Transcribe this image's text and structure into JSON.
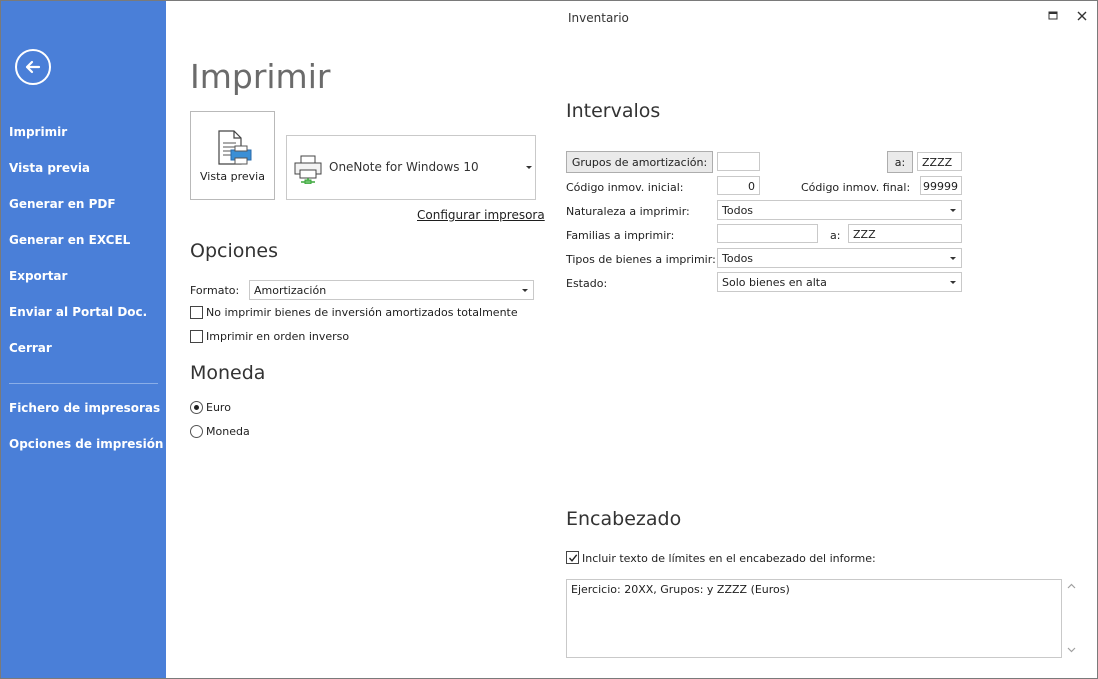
{
  "window": {
    "title": "Inventario"
  },
  "sidebar": {
    "items": [
      {
        "label": "Imprimir"
      },
      {
        "label": "Vista previa"
      },
      {
        "label": "Generar en PDF"
      },
      {
        "label": "Generar en EXCEL"
      },
      {
        "label": "Exportar"
      },
      {
        "label": "Enviar al Portal Doc."
      },
      {
        "label": "Cerrar"
      }
    ],
    "secondary_items": [
      {
        "label": "Fichero de impresoras"
      },
      {
        "label": "Opciones de impresión"
      }
    ]
  },
  "page": {
    "title": "Imprimir"
  },
  "print": {
    "preview_tile_label": "Vista previa",
    "printer_name": "OneNote for Windows 10",
    "configure_link": "Configurar impresora"
  },
  "opciones": {
    "heading": "Opciones",
    "format_label": "Formato:",
    "format_value": "Amortización",
    "checkbox_no_print": {
      "label": "No imprimir bienes de inversión amortizados totalmente",
      "checked": false
    },
    "checkbox_reverse": {
      "label": "Imprimir en orden inverso",
      "checked": false
    }
  },
  "moneda": {
    "heading": "Moneda",
    "options": [
      {
        "label": "Euro",
        "selected": true
      },
      {
        "label": "Moneda",
        "selected": false
      }
    ]
  },
  "intervalos": {
    "heading": "Intervalos",
    "grupos_button": "Grupos de amortización:",
    "grupos_from_value": "",
    "grupos_a_button": "a:",
    "grupos_to_value": "ZZZZ",
    "codigo_inicial_label": "Código inmov. inicial:",
    "codigo_inicial_value": "0",
    "codigo_final_label": "Código inmov. final:",
    "codigo_final_value": "99999",
    "naturaleza_label": "Naturaleza a imprimir:",
    "naturaleza_value": "Todos",
    "familias_label": "Familias a imprimir:",
    "familias_from_value": "",
    "familias_a_label": "a:",
    "familias_to_value": "ZZZ",
    "tipos_label": "Tipos de bienes a imprimir:",
    "tipos_value": "Todos",
    "estado_label": "Estado:",
    "estado_value": "Solo bienes en alta"
  },
  "encabezado": {
    "heading": "Encabezado",
    "include_checkbox": {
      "label": "Incluir texto de límites en el encabezado del informe:",
      "checked": true
    },
    "text": "Ejercicio: 20XX, Grupos:  y ZZZZ (Euros)"
  },
  "colors": {
    "sidebar": "#4a7fd8",
    "text": "#1e1e1e",
    "border": "#c9c9c9"
  }
}
